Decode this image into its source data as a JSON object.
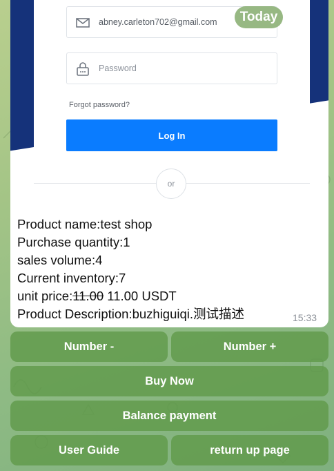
{
  "preview": {
    "email_value": "abney.carleton702@gmail.com",
    "password_placeholder": "Password",
    "forgot_label": "Forgot password?",
    "login_label": "Log In",
    "or_label": "or"
  },
  "date_badge": "Today",
  "message": {
    "product_name_label": "Product name:",
    "product_name": "test shop",
    "quantity_label": "Purchase quantity:",
    "quantity": "1",
    "sales_label": "sales volume:",
    "sales": "4",
    "inventory_label": "Current inventory:",
    "inventory": "7",
    "price_label": "unit price:",
    "price_old": "11.00",
    "price_new": " 11.00 USDT",
    "desc_label": "Product Description:",
    "desc": "buzhiguiqi.测试描述",
    "time": "15:33"
  },
  "keyboard": {
    "number_minus": "Number -",
    "number_plus": "Number +",
    "buy_now": "Buy Now",
    "balance_payment": "Balance payment",
    "user_guide": "User Guide",
    "return_up": "return up page"
  },
  "colors": {
    "accent": "#0a7cff",
    "keyboard_button": "#609a4a",
    "preview_navy": "#15327a"
  }
}
